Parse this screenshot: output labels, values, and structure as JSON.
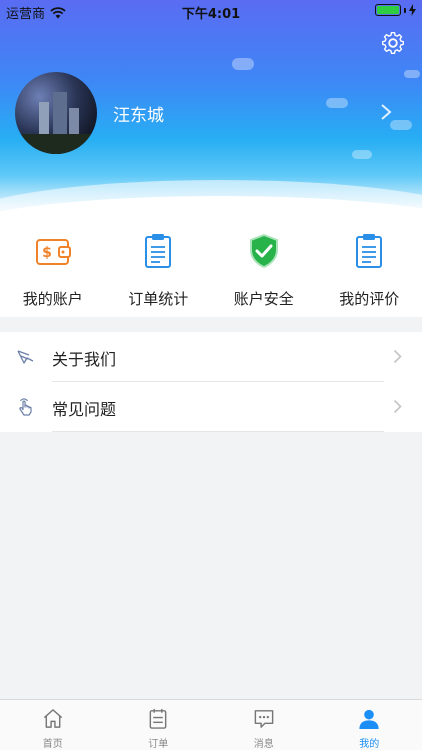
{
  "status_bar": {
    "carrier": "运营商",
    "time": "下午4:01",
    "battery_level": 1.0
  },
  "profile": {
    "user_name": "汪东城"
  },
  "actions": [
    {
      "label": "我的账户",
      "icon": "wallet-icon",
      "color": "#f0832a"
    },
    {
      "label": "订单统计",
      "icon": "clipboard-icon",
      "color": "#2a8fe6"
    },
    {
      "label": "账户安全",
      "icon": "shield-check-icon",
      "color": "#27b24a"
    },
    {
      "label": "我的评价",
      "icon": "clipboard-list-icon",
      "color": "#2a8fe6"
    }
  ],
  "menu": [
    {
      "label": "关于我们",
      "icon": "info-hand-icon"
    },
    {
      "label": "常见问题",
      "icon": "tap-hand-icon"
    }
  ],
  "tabbar": {
    "active_color": "#1b8ff5",
    "items": [
      {
        "label": "首页",
        "icon": "home-icon"
      },
      {
        "label": "订单",
        "icon": "order-icon"
      },
      {
        "label": "消息",
        "icon": "message-icon"
      },
      {
        "label": "我的",
        "icon": "user-icon",
        "active": true
      }
    ]
  }
}
